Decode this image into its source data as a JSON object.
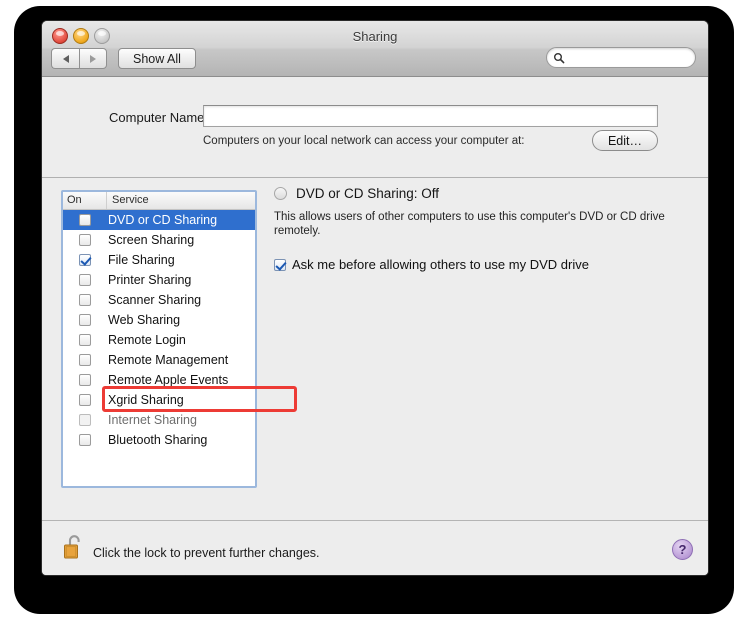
{
  "window": {
    "title": "Sharing",
    "traffic_lights": [
      "close",
      "minimize",
      "zoom"
    ]
  },
  "toolbar": {
    "back_label": "◀",
    "forward_label": "▶",
    "show_all_label": "Show All",
    "search_placeholder": "",
    "search_value": ""
  },
  "computer_name": {
    "label": "Computer Name:",
    "value": "",
    "placeholder": "",
    "hint": "Computers on your local network can access your computer at:",
    "edit_label": "Edit…"
  },
  "service_list": {
    "headers": {
      "on": "On",
      "service": "Service"
    },
    "items": [
      {
        "label": "DVD or CD Sharing",
        "checked": false,
        "selected": true,
        "enabled": true
      },
      {
        "label": "Screen Sharing",
        "checked": false,
        "selected": false,
        "enabled": true
      },
      {
        "label": "File Sharing",
        "checked": true,
        "selected": false,
        "enabled": true
      },
      {
        "label": "Printer Sharing",
        "checked": false,
        "selected": false,
        "enabled": true
      },
      {
        "label": "Scanner Sharing",
        "checked": false,
        "selected": false,
        "enabled": true
      },
      {
        "label": "Web Sharing",
        "checked": false,
        "selected": false,
        "enabled": true
      },
      {
        "label": "Remote Login",
        "checked": false,
        "selected": false,
        "enabled": true
      },
      {
        "label": "Remote Management",
        "checked": false,
        "selected": false,
        "enabled": true
      },
      {
        "label": "Remote Apple Events",
        "checked": false,
        "selected": false,
        "enabled": true
      },
      {
        "label": "Xgrid Sharing",
        "checked": false,
        "selected": false,
        "enabled": true
      },
      {
        "label": "Internet Sharing",
        "checked": false,
        "selected": false,
        "enabled": false
      },
      {
        "label": "Bluetooth Sharing",
        "checked": false,
        "selected": false,
        "enabled": true
      }
    ]
  },
  "detail": {
    "status": "DVD or CD Sharing: Off",
    "description": "This allows users of other computers to use this computer's DVD or CD drive remotely.",
    "ask_label": "Ask me before allowing others to use my DVD drive",
    "ask_checked": true
  },
  "bottom": {
    "lock_text": "Click the lock to prevent further changes.",
    "lock_state": "unlocked",
    "help_label": "?"
  },
  "annotation": {
    "color": "#ed3b35",
    "target": "DVD or CD Sharing"
  },
  "colors": {
    "selection_blue": "#2f6fce",
    "annotation_red": "#ed3b35",
    "window_bg": "#ededed",
    "help_purple": "#b99ad6"
  }
}
